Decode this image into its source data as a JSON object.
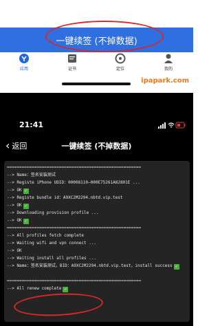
{
  "top": {
    "banner_title": "一键续签 (不掉数据)",
    "tabs": [
      {
        "label": "应用",
        "icon": "app-icon",
        "active": true
      },
      {
        "label": "证书",
        "icon": "certificate-icon",
        "active": false
      },
      {
        "label": "定位",
        "icon": "location-icon",
        "active": false
      },
      {
        "label": "我的",
        "icon": "profile-icon",
        "active": false
      }
    ],
    "watermark": "ipapark.com"
  },
  "bottom": {
    "status_time": "21:41",
    "back_label": "返回",
    "nav_title": "一键续签 (不掉数据)",
    "log_lines": [
      {
        "text": "======================================================",
        "ok": false
      },
      {
        "text": "--> Name：签名安装测试",
        "ok": false
      },
      {
        "text": "--> Registe iPhone UDID：00008110–000E75261A82801E ...",
        "ok": false
      },
      {
        "text": "--> OK",
        "ok": true
      },
      {
        "text": "--> Registe bundle id：A9XC2M2294.nbtd.vip.test",
        "ok": false
      },
      {
        "text": "--> OK",
        "ok": true
      },
      {
        "text": "--> Downloading provision profile ...",
        "ok": false
      },
      {
        "text": "--> OK",
        "ok": true
      },
      {
        "text": "======================================================",
        "ok": false
      },
      {
        "text": "--> All profiles fetch complete",
        "ok": false
      },
      {
        "text": "--> Waiting wifi and vpn connect ...",
        "ok": false
      },
      {
        "text": "--> OK",
        "ok": false
      },
      {
        "text": "--> Waiting install all profiles ...",
        "ok": false
      },
      {
        "text": "--> Name：签名安装测试，BID：A9XC2M2294.nbtd.vip.test，install success",
        "ok": true,
        "wrap": true
      },
      {
        "text": "======================================================",
        "ok": false
      },
      {
        "text": "--> All renew complete",
        "ok": true
      }
    ]
  },
  "colors": {
    "banner_blue": "#2F6FE0",
    "active_tab": "#1E66E0",
    "watermark_orange": "#F07A1A",
    "annotation_red": "#D8282A",
    "ok_green": "#49B03B",
    "console_bg": "#242424"
  }
}
